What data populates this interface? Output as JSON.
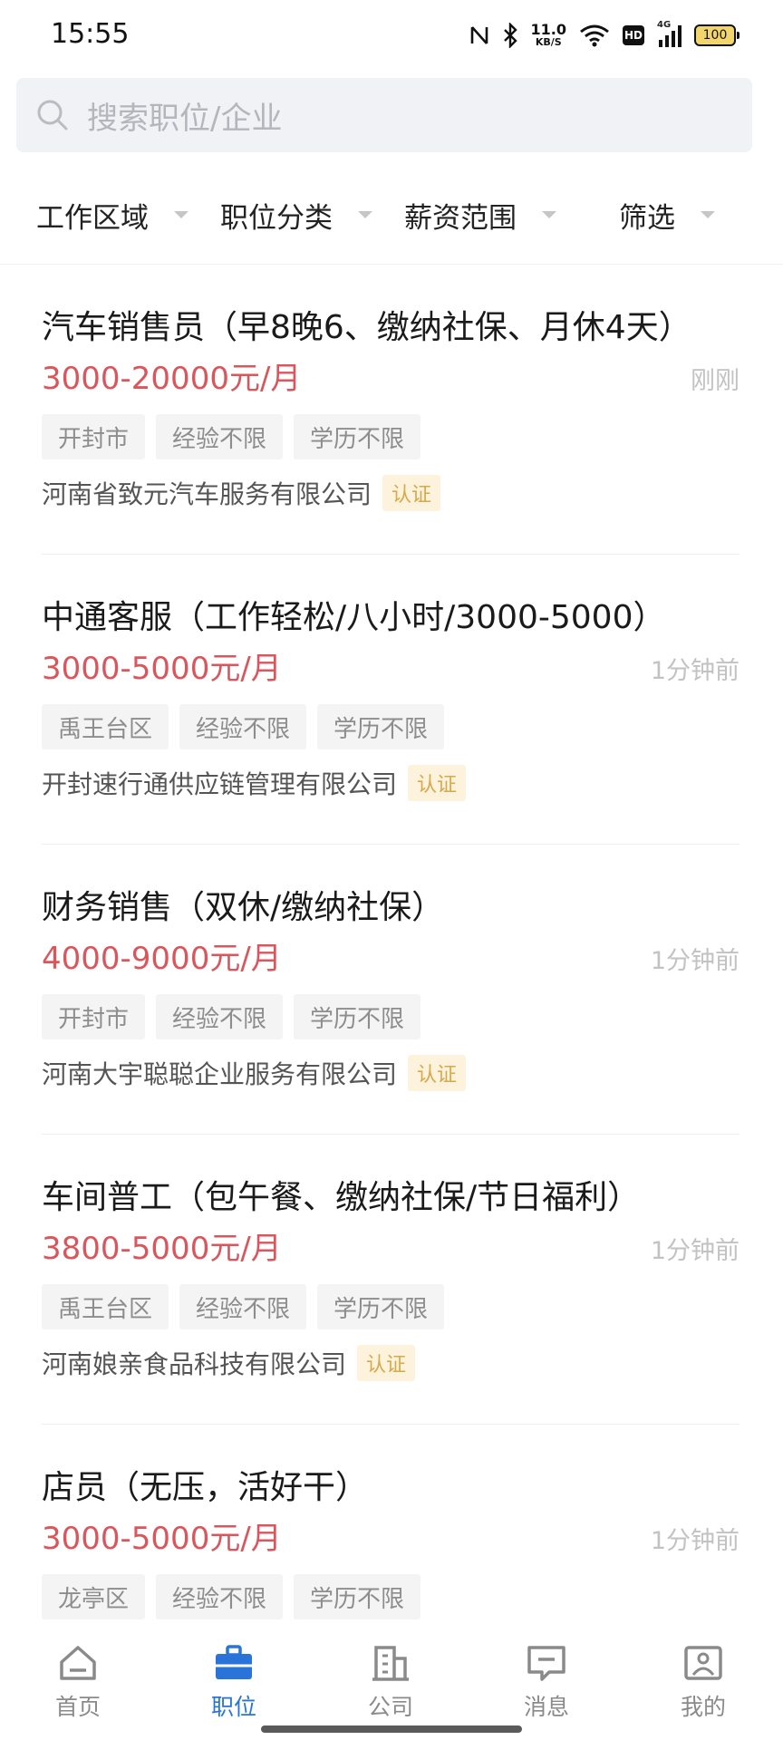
{
  "status_bar": {
    "time": "15:55",
    "net_speed_value": "11.0",
    "net_speed_unit": "KB/S",
    "hd_label": "HD",
    "signal_label": "4G",
    "battery": "100"
  },
  "search": {
    "placeholder": "搜索职位/企业"
  },
  "filters": [
    {
      "label": "工作区域"
    },
    {
      "label": "职位分类"
    },
    {
      "label": "薪资范围"
    },
    {
      "label": "筛选"
    }
  ],
  "jobs": [
    {
      "title": "汽车销售员（早8晚6、缴纳社保、月休4天）",
      "salary": "3000-20000元/月",
      "time": "刚刚",
      "tags": [
        "开封市",
        "经验不限",
        "学历不限"
      ],
      "company": "河南省致元汽车服务有限公司",
      "badge": "认证"
    },
    {
      "title": "中通客服（工作轻松/八小时/3000-5000）",
      "salary": "3000-5000元/月",
      "time": "1分钟前",
      "tags": [
        "禹王台区",
        "经验不限",
        "学历不限"
      ],
      "company": "开封速行通供应链管理有限公司",
      "badge": "认证"
    },
    {
      "title": "财务销售（双休/缴纳社保）",
      "salary": "4000-9000元/月",
      "time": "1分钟前",
      "tags": [
        "开封市",
        "经验不限",
        "学历不限"
      ],
      "company": "河南大宇聪聪企业服务有限公司",
      "badge": "认证"
    },
    {
      "title": "车间普工（包午餐、缴纳社保/节日福利）",
      "salary": "3800-5000元/月",
      "time": "1分钟前",
      "tags": [
        "禹王台区",
        "经验不限",
        "学历不限"
      ],
      "company": "河南娘亲食品科技有限公司",
      "badge": "认证"
    },
    {
      "title": "店员（无压，活好干）",
      "salary": "3000-5000元/月",
      "time": "1分钟前",
      "tags": [
        "龙亭区",
        "经验不限",
        "学历不限"
      ],
      "company": "",
      "badge": ""
    }
  ],
  "bottom_nav": [
    {
      "label": "首页",
      "icon": "home-icon",
      "active": false
    },
    {
      "label": "职位",
      "icon": "briefcase-icon",
      "active": true
    },
    {
      "label": "公司",
      "icon": "building-icon",
      "active": false
    },
    {
      "label": "消息",
      "icon": "message-icon",
      "active": false
    },
    {
      "label": "我的",
      "icon": "profile-icon",
      "active": false
    }
  ],
  "colors": {
    "salary": "#d9575c",
    "active_nav": "#2a73d9",
    "badge_bg": "#fdf3dc",
    "badge_text": "#d5a94c"
  }
}
